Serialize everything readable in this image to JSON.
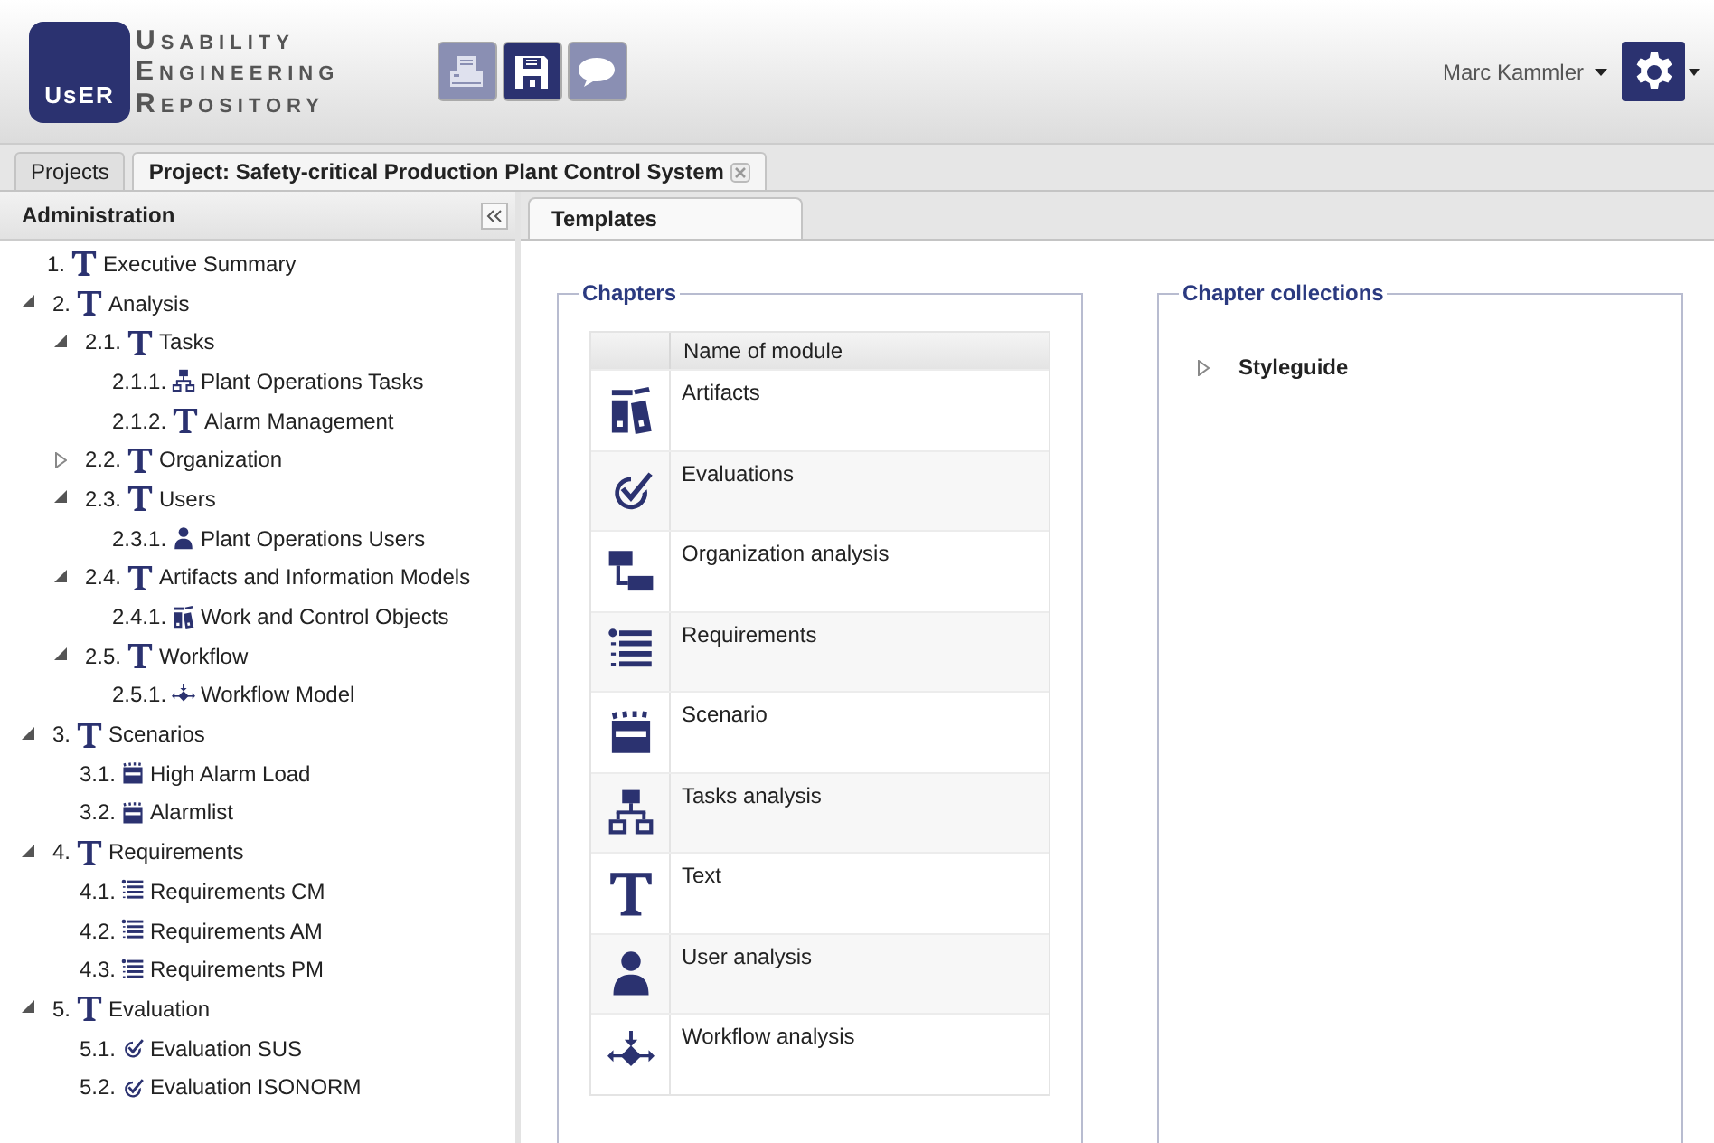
{
  "logo": {
    "mark": "UsER",
    "lines": [
      "Usability",
      "Engineering",
      "Repository"
    ]
  },
  "toolbar": [
    {
      "kind": "print",
      "disabled": true
    },
    {
      "kind": "save",
      "disabled": false
    },
    {
      "kind": "comment",
      "disabled": true
    }
  ],
  "user": {
    "name": "Marc Kammler"
  },
  "project_tabs": [
    {
      "label": "Projects",
      "selected": false,
      "closable": false
    },
    {
      "label": "Project: Safety-critical Production Plant Control System",
      "selected": true,
      "closable": true
    }
  ],
  "sidebar": {
    "title": "Administration",
    "items": [
      {
        "number": "1.",
        "kind": "text",
        "label": "Executive Summary"
      },
      {
        "number": "2.",
        "kind": "text",
        "label": "Analysis",
        "expanded": true,
        "children": [
          {
            "number": "2.1.",
            "kind": "text",
            "label": "Tasks",
            "expanded": true,
            "children": [
              {
                "number": "2.1.1.",
                "kind": "tasks",
                "label": "Plant Operations Tasks"
              },
              {
                "number": "2.1.2.",
                "kind": "text",
                "label": "Alarm Management"
              }
            ]
          },
          {
            "number": "2.2.",
            "kind": "text",
            "label": "Organization",
            "expanded": false
          },
          {
            "number": "2.3.",
            "kind": "text",
            "label": "Users",
            "expanded": true,
            "children": [
              {
                "number": "2.3.1.",
                "kind": "user",
                "label": "Plant Operations Users"
              }
            ]
          },
          {
            "number": "2.4.",
            "kind": "text",
            "label": "Artifacts and Information Models",
            "expanded": true,
            "children": [
              {
                "number": "2.4.1.",
                "kind": "artifacts",
                "label": "Work and Control Objects"
              }
            ]
          },
          {
            "number": "2.5.",
            "kind": "text",
            "label": "Workflow",
            "expanded": true,
            "children": [
              {
                "number": "2.5.1.",
                "kind": "workflow",
                "label": "Workflow Model"
              }
            ]
          }
        ]
      },
      {
        "number": "3.",
        "kind": "text",
        "label": "Scenarios",
        "expanded": true,
        "children": [
          {
            "number": "3.1.",
            "kind": "scenario",
            "label": "High Alarm Load"
          },
          {
            "number": "3.2.",
            "kind": "scenario",
            "label": "Alarmlist"
          }
        ]
      },
      {
        "number": "4.",
        "kind": "text",
        "label": "Requirements",
        "expanded": true,
        "children": [
          {
            "number": "4.1.",
            "kind": "requirements",
            "label": "Requirements CM"
          },
          {
            "number": "4.2.",
            "kind": "requirements",
            "label": "Requirements AM"
          },
          {
            "number": "4.3.",
            "kind": "requirements",
            "label": "Requirements PM"
          }
        ]
      },
      {
        "number": "5.",
        "kind": "text",
        "label": "Evaluation",
        "expanded": true,
        "children": [
          {
            "number": "5.1.",
            "kind": "evaluation",
            "label": "Evaluation SUS"
          },
          {
            "number": "5.2.",
            "kind": "evaluation",
            "label": "Evaluation ISONORM"
          }
        ]
      }
    ]
  },
  "content_tabs": [
    {
      "label": "Templates",
      "selected": true
    }
  ],
  "chapters": {
    "title": "Chapters",
    "columns": [
      "Name of module"
    ],
    "rows": [
      {
        "kind": "artifacts",
        "name": "Artifacts"
      },
      {
        "kind": "evaluation",
        "name": "Evaluations"
      },
      {
        "kind": "organization",
        "name": "Organization analysis"
      },
      {
        "kind": "requirements",
        "name": "Requirements"
      },
      {
        "kind": "scenario",
        "name": "Scenario"
      },
      {
        "kind": "tasks",
        "name": "Tasks analysis"
      },
      {
        "kind": "text",
        "name": "Text"
      },
      {
        "kind": "user",
        "name": "User analysis"
      },
      {
        "kind": "workflow",
        "name": "Workflow analysis"
      }
    ]
  },
  "chapter_collections": {
    "title": "Chapter collections",
    "items": [
      {
        "label": "Styleguide",
        "expanded": false
      }
    ]
  }
}
